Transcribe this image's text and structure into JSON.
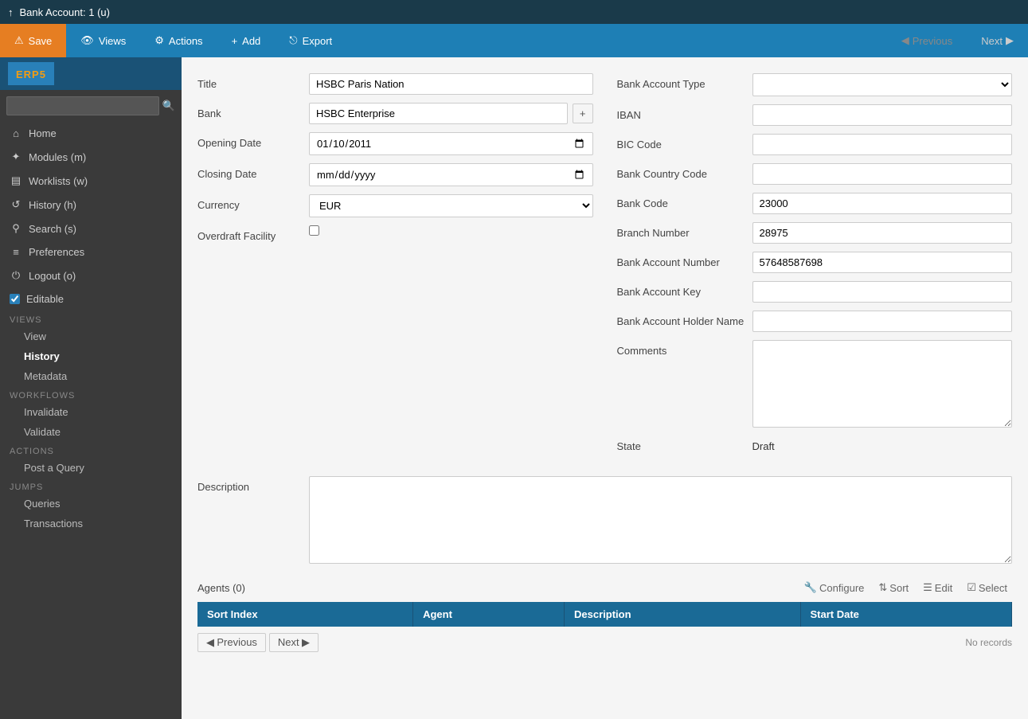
{
  "topbar": {
    "icon": "↑",
    "title": "Bank Account:",
    "detail": "1 (u)"
  },
  "toolbar": {
    "save_label": "Save",
    "views_label": "Views",
    "actions_label": "Actions",
    "add_label": "Add",
    "export_label": "Export",
    "previous_label": "Previous",
    "next_label": "Next"
  },
  "sidebar": {
    "logo": "ERP",
    "logo_num": "5",
    "search_placeholder": "",
    "nav_items": [
      {
        "icon": "⌂",
        "label": "Home"
      },
      {
        "icon": "✦",
        "label": "Modules (m)"
      },
      {
        "icon": "▤",
        "label": "Worklists (w)"
      },
      {
        "icon": "↺",
        "label": "History (h)"
      },
      {
        "icon": "⚲",
        "label": "Search (s)"
      },
      {
        "icon": "≡",
        "label": "Preferences"
      },
      {
        "icon": "⏻",
        "label": "Logout (o)"
      }
    ],
    "editable_label": "Editable",
    "views_section": "VIEWS",
    "views_items": [
      "View",
      "History",
      "Metadata"
    ],
    "workflows_section": "WORKFLOWS",
    "workflow_items": [
      "Invalidate",
      "Validate"
    ],
    "actions_section": "ACTIONS",
    "action_items": [
      "Post a Query"
    ],
    "jumps_section": "JUMPS",
    "jump_items": [
      "Queries",
      "Transactions"
    ]
  },
  "form": {
    "title_label": "Title",
    "title_value": "HSBC Paris Nation",
    "bank_label": "Bank",
    "bank_value": "HSBC Enterprise",
    "opening_date_label": "Opening Date",
    "opening_date_value": "01/10/2011",
    "closing_date_label": "Closing Date",
    "closing_date_value": "",
    "closing_date_placeholder": "mm/dd/yyyy",
    "currency_label": "Currency",
    "currency_value": "EUR",
    "overdraft_label": "Overdraft Facility",
    "bank_account_type_label": "Bank Account Type",
    "bank_account_type_value": "",
    "iban_label": "IBAN",
    "iban_value": "",
    "bic_label": "BIC Code",
    "bic_value": "",
    "bank_country_label": "Bank Country Code",
    "bank_country_value": "",
    "bank_code_label": "Bank Code",
    "bank_code_value": "23000",
    "branch_number_label": "Branch Number",
    "branch_number_value": "28975",
    "bank_account_number_label": "Bank Account Number",
    "bank_account_number_value": "57648587698",
    "bank_account_key_label": "Bank Account Key",
    "bank_account_key_value": "",
    "bank_account_holder_label": "Bank Account Holder Name",
    "bank_account_holder_value": "",
    "comments_label": "Comments",
    "comments_value": "",
    "state_label": "State",
    "state_value": "Draft",
    "description_label": "Description",
    "description_value": ""
  },
  "agents": {
    "title": "Agents (0)",
    "configure_label": "Configure",
    "sort_label": "Sort",
    "edit_label": "Edit",
    "select_label": "Select",
    "columns": [
      "Sort Index",
      "Agent",
      "Description",
      "Start Date"
    ],
    "no_records": "No records",
    "previous_label": "Previous",
    "next_label": "Next"
  }
}
